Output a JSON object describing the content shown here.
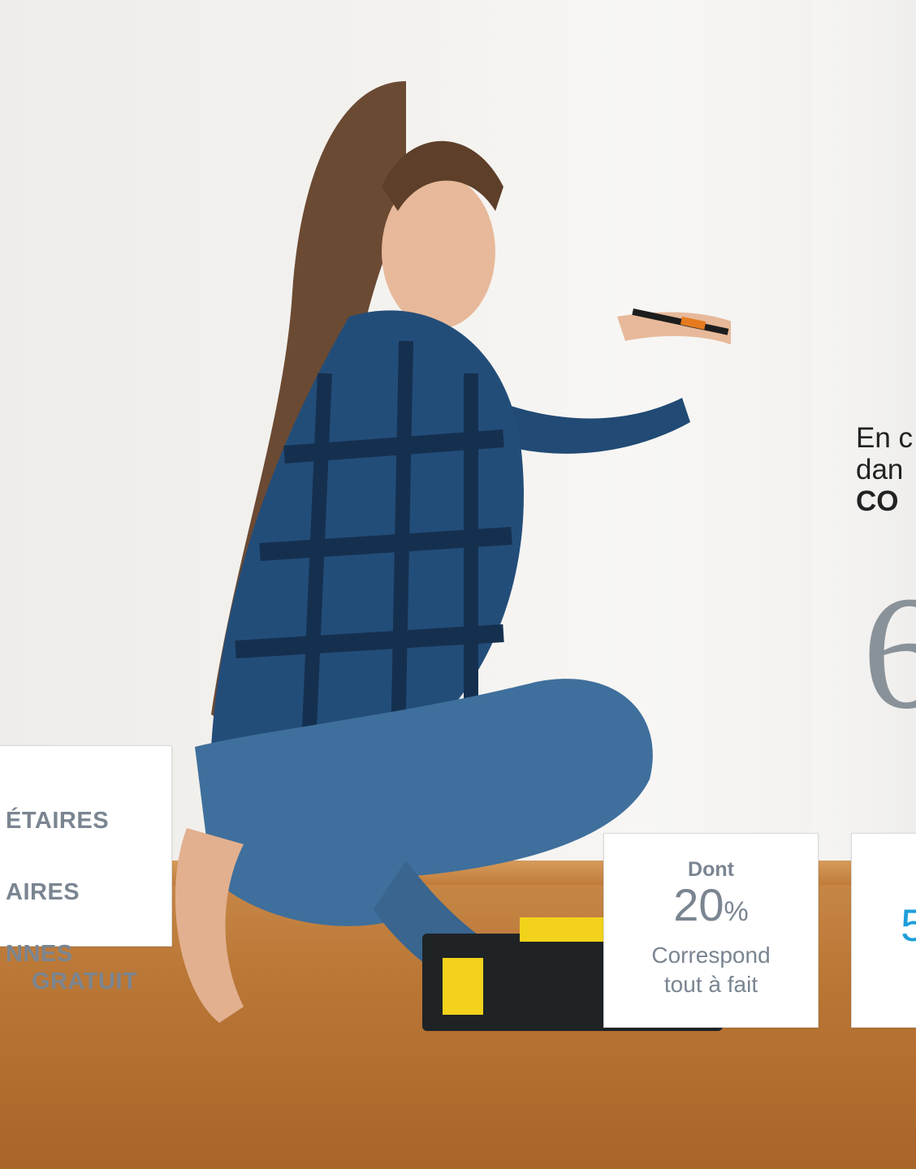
{
  "intro": {
    "line1": "En c",
    "line2": "dan",
    "line3": "CO"
  },
  "big_number": "6",
  "left_card": {
    "lines": [
      "ÉTAIRES",
      "AIRES",
      "NNES",
      "GRATUIT"
    ]
  },
  "mid_card": {
    "kicker": "Dont",
    "value": "20",
    "unit": "%",
    "sub_line1": "Correspond",
    "sub_line2": "tout à fait"
  },
  "right_card": {
    "value": "5"
  },
  "colors": {
    "accent_blue": "#1e9fd8",
    "muted_gray": "#7a8591"
  }
}
